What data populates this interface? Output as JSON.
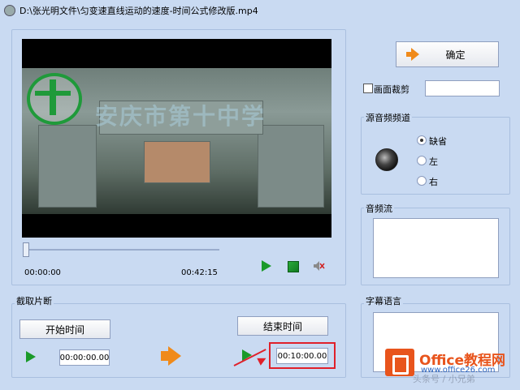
{
  "window": {
    "title": "D:\\张光明文件\\匀变速直线运动的速度-时间公式修改版.mp4"
  },
  "video": {
    "watermark": "安庆市第十中学"
  },
  "player": {
    "current_time": "00:00:00",
    "total_time": "00:42:15"
  },
  "clip": {
    "section_label": "截取片断",
    "start_label": "开始时间",
    "end_label": "结束时间",
    "start_value": "00:00:00.00",
    "end_value": "00:10:00.00"
  },
  "confirm": {
    "label": "确定"
  },
  "crop": {
    "label": "画面裁剪",
    "value": ""
  },
  "audio_channel": {
    "label": "源音频频道",
    "options": [
      "缺省",
      "左",
      "右"
    ],
    "selected": "缺省"
  },
  "audio_stream": {
    "label": "音频流"
  },
  "subtitle": {
    "label": "字幕语言"
  },
  "brand": {
    "name": "Office教程网",
    "url": "www.office26.com"
  },
  "overlay_watermark": "头条号 / 小兄弟"
}
